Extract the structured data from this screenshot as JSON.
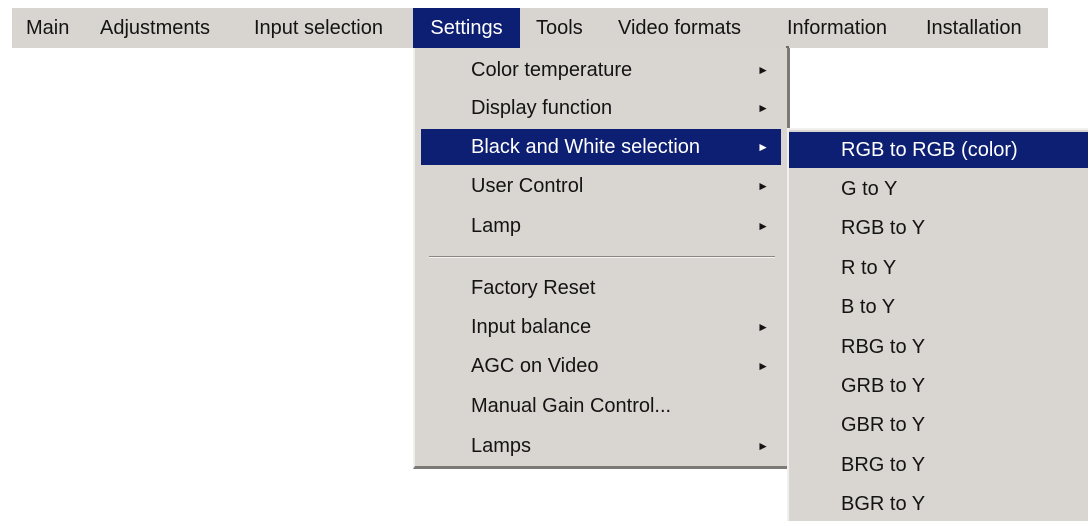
{
  "menubar": {
    "items": [
      {
        "label": "Main"
      },
      {
        "label": "Adjustments"
      },
      {
        "label": "Input selection"
      },
      {
        "label": "Settings"
      },
      {
        "label": "Tools"
      },
      {
        "label": "Video formats"
      },
      {
        "label": "Information"
      },
      {
        "label": "Installation"
      }
    ],
    "active": "Settings"
  },
  "settings_menu": {
    "items": [
      {
        "label": "Color temperature",
        "submenu": true
      },
      {
        "label": "Display function",
        "submenu": true
      },
      {
        "label": "Black and White selection",
        "submenu": true,
        "selected": true
      },
      {
        "label": "User Control",
        "submenu": true
      },
      {
        "label": "Lamp",
        "submenu": true
      },
      {
        "label": "Factory Reset",
        "submenu": false
      },
      {
        "label": "Input balance",
        "submenu": true
      },
      {
        "label": "AGC on Video",
        "submenu": true
      },
      {
        "label": "Manual Gain Control...",
        "submenu": false
      },
      {
        "label": "Lamps",
        "submenu": true
      }
    ],
    "arrow_glyph": "►"
  },
  "bw_submenu": {
    "items": [
      {
        "label": "RGB to RGB (color)",
        "selected": true
      },
      {
        "label": "G to Y"
      },
      {
        "label": "RGB to Y"
      },
      {
        "label": "R to Y"
      },
      {
        "label": "B to Y"
      },
      {
        "label": "RBG to Y"
      },
      {
        "label": "GRB to Y"
      },
      {
        "label": "GBR to Y"
      },
      {
        "label": "BRG to Y"
      },
      {
        "label": "BGR to Y"
      }
    ]
  },
  "colors": {
    "menu_background": "#d9d5d0",
    "highlight": "#0d1f73",
    "highlight_text": "#ffffff"
  }
}
